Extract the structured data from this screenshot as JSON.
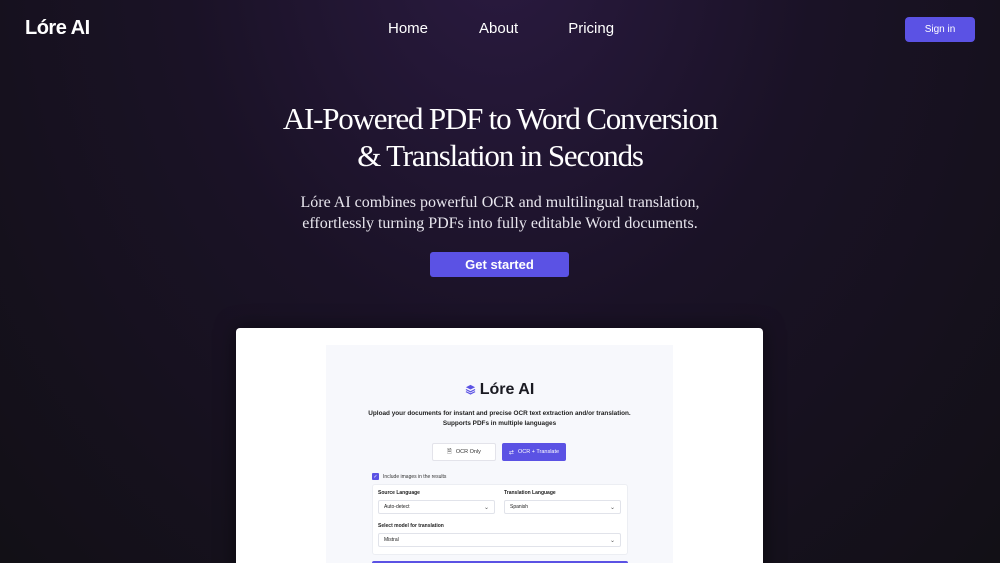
{
  "nav": {
    "logo": "Lóre AI",
    "links": [
      "Home",
      "About",
      "Pricing"
    ],
    "signin": "Sign in"
  },
  "hero": {
    "title_line1": "AI-Powered PDF to Word Conversion",
    "title_line2": "& Translation in Seconds",
    "sub_line1": "Lóre AI combines powerful OCR and multilingual translation,",
    "sub_line2": "effortlessly turning PDFs into fully editable Word documents.",
    "cta": "Get started"
  },
  "preview": {
    "logo": "Lóre AI",
    "desc_line1": "Upload your documents for instant and precise OCR text extraction and/or translation.",
    "desc_line2": "Supports PDFs in multiple languages",
    "mode_ocr": "OCR Only",
    "mode_translate": "OCR + Translate",
    "include_images": "Include images in the results",
    "source_label": "Source Language",
    "source_value": "Auto-detect",
    "target_label": "Translation Language",
    "target_value": "Spanish",
    "model_label": "Select model for translation",
    "model_value": "Mistral"
  },
  "colors": {
    "accent": "#5b52e4",
    "background": "#16111e"
  }
}
